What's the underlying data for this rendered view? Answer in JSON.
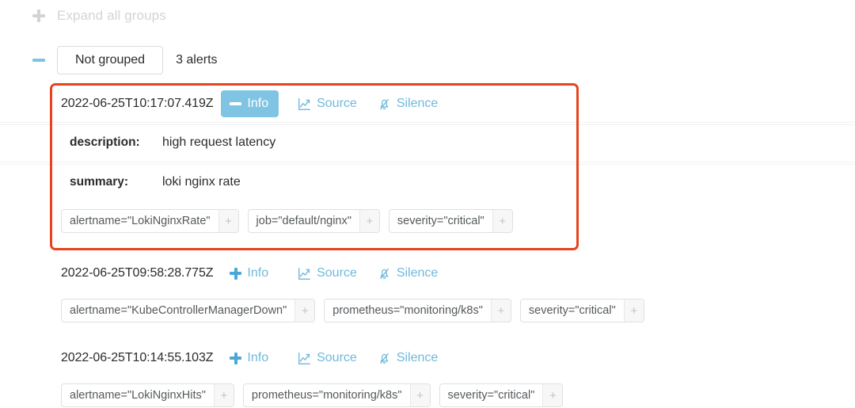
{
  "toolbar": {
    "expand_all_label": "Expand all groups",
    "expand_all_icon": "plus-icon"
  },
  "group": {
    "collapse_icon": "minus-icon",
    "pill_label": "Not grouped",
    "count_label": "3 alerts"
  },
  "actions": {
    "info_label": "Info",
    "source_label": "Source",
    "silence_label": "Silence",
    "source_icon": "line-chart-icon",
    "silence_icon": "bell-slash-icon",
    "chip_add_symbol": "+"
  },
  "colors": {
    "accent_blue": "#7fc5e3",
    "link_blue": "#6fb9db",
    "highlight_red": "#e8431f",
    "chip_border": "#e0e0e0",
    "muted_text": "#d4d4d4"
  },
  "alerts": [
    {
      "timestamp": "2022-06-25T10:17:07.419Z",
      "expanded": true,
      "annotations": [
        {
          "key": "description:",
          "value": "high request latency"
        },
        {
          "key": "summary:",
          "value": "loki nginx rate"
        }
      ],
      "labels": [
        "alertname=\"LokiNginxRate\"",
        "job=\"default/nginx\"",
        "severity=\"critical\""
      ]
    },
    {
      "timestamp": "2022-06-25T09:58:28.775Z",
      "expanded": false,
      "annotations": [],
      "labels": [
        "alertname=\"KubeControllerManagerDown\"",
        "prometheus=\"monitoring/k8s\"",
        "severity=\"critical\""
      ]
    },
    {
      "timestamp": "2022-06-25T10:14:55.103Z",
      "expanded": false,
      "annotations": [],
      "labels": [
        "alertname=\"LokiNginxHits\"",
        "prometheus=\"monitoring/k8s\"",
        "severity=\"critical\""
      ]
    }
  ]
}
